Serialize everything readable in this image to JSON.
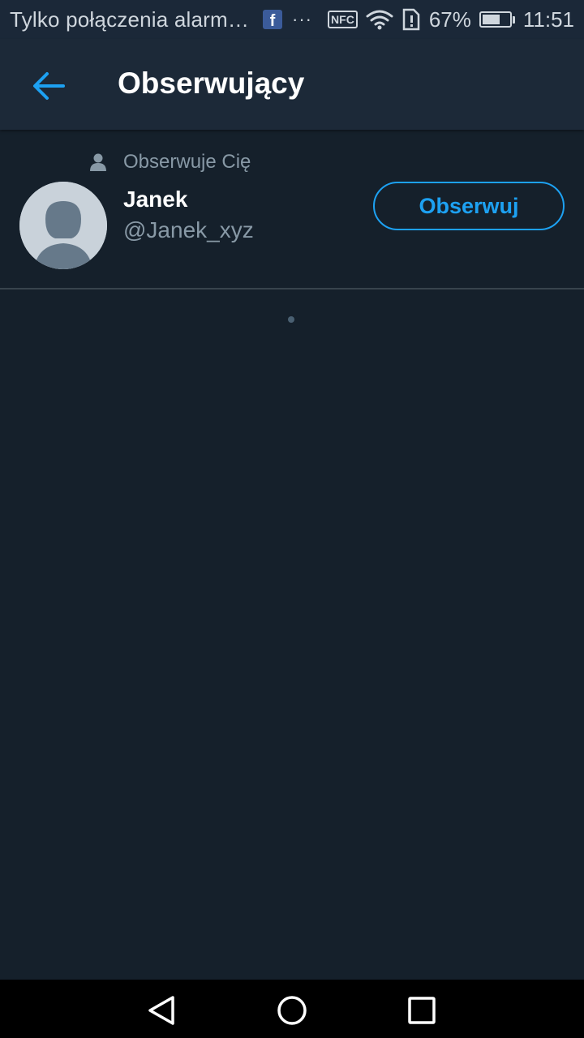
{
  "status_bar": {
    "notification_text": "Tylko połączenia alarmo...",
    "more_dots": "···",
    "nfc_label": "NFC",
    "battery_percent": "67%",
    "battery_level": 0.67,
    "time": "11:51"
  },
  "header": {
    "title": "Obserwujący",
    "back_icon": "arrow-left-icon",
    "accent_color": "#1da1f2"
  },
  "followers": [
    {
      "context_label": "Obserwuje Cię",
      "name": "Janek",
      "handle": "@Janek_xyz",
      "follow_label": "Obserwuj"
    }
  ],
  "colors": {
    "background": "#15202b",
    "header_background": "#1c2938",
    "secondary_text": "#8899a6",
    "accent": "#1da1f2"
  },
  "nav_bar": {
    "icons": [
      "back-triangle-icon",
      "home-circle-icon",
      "recents-square-icon"
    ]
  }
}
